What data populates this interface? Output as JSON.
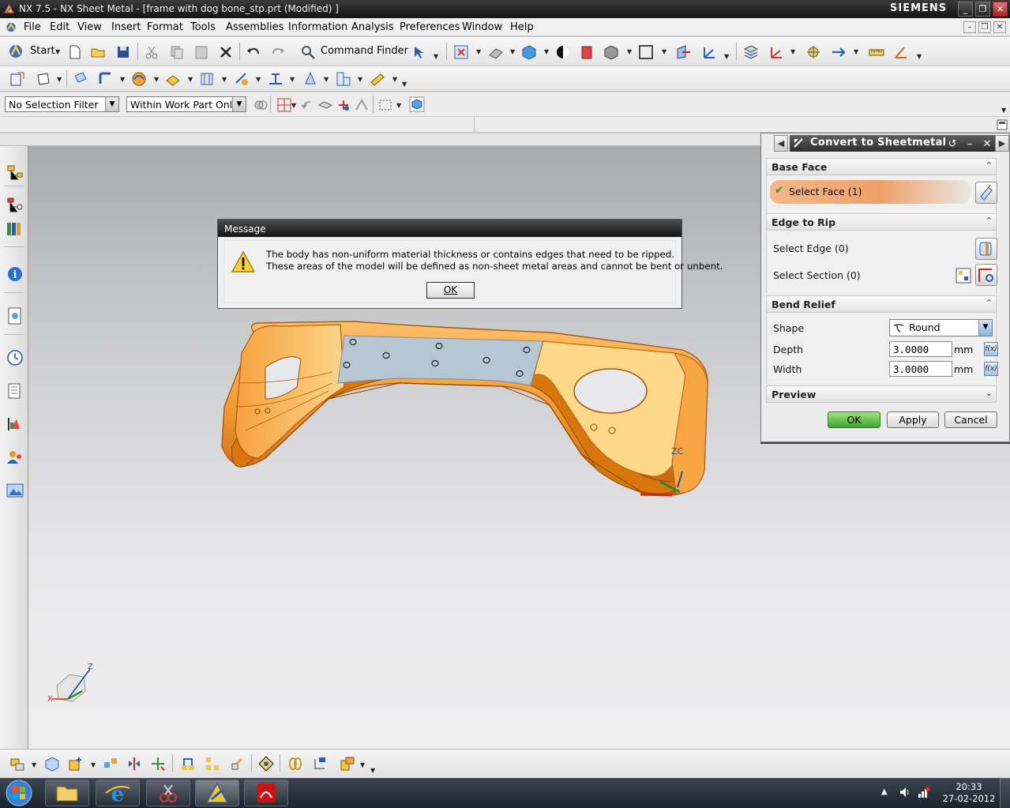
{
  "window": {
    "title": "NX 7.5 - NX Sheet Metal - [frame with dog bone_stp.prt (Modified) ]",
    "brand": "SIEMENS",
    "controls": {
      "minimize": "_",
      "maximize": "❐",
      "close": "✕"
    }
  },
  "menubar": {
    "items": [
      "File",
      "Edit",
      "View",
      "Insert",
      "Format",
      "Tools",
      "Assemblies",
      "Information",
      "Analysis",
      "Preferences",
      "Window",
      "Help"
    ]
  },
  "toolbar": {
    "start_label": "Start",
    "command_finder_label": "Command Finder",
    "selection_filter": "No Selection Filter",
    "selection_scope": "Within Work Part Only"
  },
  "dialog": {
    "title": "Convert to Sheetmetal",
    "sections": {
      "base_face": {
        "title": "Base Face",
        "select_face": "Select Face (1)"
      },
      "edge_to_rip": {
        "title": "Edge to Rip",
        "select_edge": "Select Edge (0)",
        "select_section": "Select Section (0)"
      },
      "bend_relief": {
        "title": "Bend Relief",
        "shape_label": "Shape",
        "shape_value": "Round",
        "depth_label": "Depth",
        "depth_value": "3.0000",
        "depth_unit": "mm",
        "width_label": "Width",
        "width_value": "3.0000",
        "width_unit": "mm"
      },
      "preview": {
        "title": "Preview"
      }
    },
    "buttons": {
      "ok": "OK",
      "apply": "Apply",
      "cancel": "Cancel"
    }
  },
  "message": {
    "title": "Message",
    "line1": "The body has non-uniform material thickness or contains edges that need to be ripped.",
    "line2": "These areas of the model will be defined as non-sheet metal areas and cannot be bent or unbent.",
    "ok": "OK"
  },
  "viewport": {
    "axis_label_zc": "ZC",
    "triad": {
      "z": "Z",
      "x": "X"
    }
  },
  "taskbar": {
    "time": "20:33",
    "date": "27-02-2012"
  },
  "colors": {
    "part_orange": "#f7a540",
    "selected_face": "#b9c7d3",
    "ok_green": "#4cae3c"
  }
}
